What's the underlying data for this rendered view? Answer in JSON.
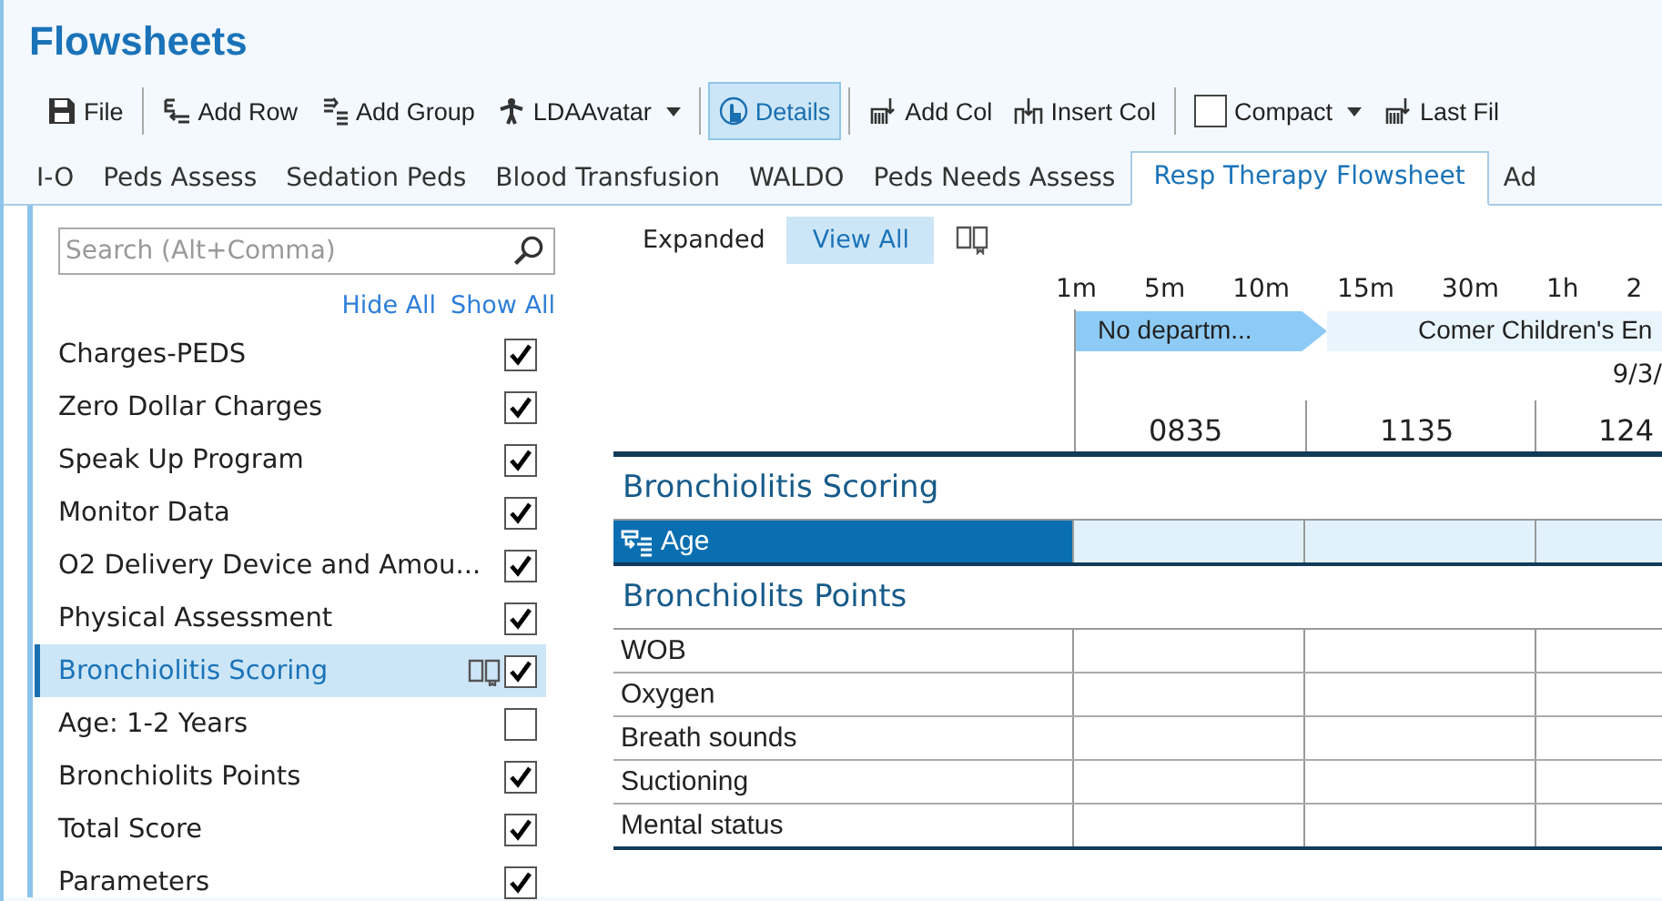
{
  "window": {
    "title": "Flowsheets"
  },
  "toolbar_groups": [
    [
      {
        "label": "File",
        "kind": "save",
        "selected": false,
        "dropdown": false
      }
    ],
    [
      {
        "label": "Add Row",
        "kind": "addrow",
        "selected": false,
        "dropdown": false
      },
      {
        "label": "Add Group",
        "kind": "addgroup",
        "selected": false,
        "dropdown": false
      },
      {
        "label": "LDAAvatar",
        "kind": "figure",
        "selected": false,
        "dropdown": true
      }
    ],
    [
      {
        "label": "Details",
        "kind": "hand",
        "selected": true,
        "dropdown": false
      }
    ],
    [
      {
        "label": "Add Col",
        "kind": "addcol",
        "selected": false,
        "dropdown": false
      },
      {
        "label": "Insert Col",
        "kind": "insertcol",
        "selected": false,
        "dropdown": false
      }
    ],
    [
      {
        "label": "Compact",
        "kind": "checkbox",
        "selected": false,
        "dropdown": true
      },
      {
        "label": "Last Fil",
        "kind": "addcol",
        "selected": false,
        "dropdown": false
      }
    ]
  ],
  "tabs": [
    {
      "label": "I-O",
      "selected": false
    },
    {
      "label": "Peds Assess",
      "selected": false
    },
    {
      "label": "Sedation Peds",
      "selected": false
    },
    {
      "label": "Blood Transfusion",
      "selected": false
    },
    {
      "label": "WALDO",
      "selected": false
    },
    {
      "label": "Peds Needs Assess",
      "selected": false
    },
    {
      "label": "Resp Therapy Flowsheet",
      "selected": true
    },
    {
      "label": "Ad",
      "selected": false
    }
  ],
  "sidebar": {
    "search": {
      "placeholder": "Search (Alt+Comma)"
    },
    "links": [
      "Hide All",
      "Show All"
    ],
    "items": [
      {
        "label": "Charges-PEDS",
        "checked": true,
        "selected": false
      },
      {
        "label": "Zero Dollar Charges",
        "checked": true,
        "selected": false
      },
      {
        "label": "Speak Up Program",
        "checked": true,
        "selected": false
      },
      {
        "label": "Monitor Data",
        "checked": true,
        "selected": false
      },
      {
        "label": "O2 Delivery Device and Amou...",
        "checked": true,
        "selected": false
      },
      {
        "label": "Physical Assessment",
        "checked": true,
        "selected": false
      },
      {
        "label": "Bronchiolitis Scoring",
        "checked": true,
        "selected": true
      },
      {
        "label": "Age:  1-2 Years",
        "checked": false,
        "selected": false
      },
      {
        "label": "Bronchiolits Points",
        "checked": true,
        "selected": false
      },
      {
        "label": "Total Score",
        "checked": true,
        "selected": false
      },
      {
        "label": "Parameters",
        "checked": true,
        "selected": false
      }
    ]
  },
  "view_buttons": [
    {
      "label": "Expanded",
      "selected": false
    },
    {
      "label": "View All",
      "selected": true
    }
  ],
  "time_scale": [
    "1m",
    "5m",
    "10m",
    "15m",
    "30m",
    "1h",
    "2"
  ],
  "departments": [
    {
      "label": "No departm...",
      "current": true
    },
    {
      "label": "Comer Children's En",
      "current": false
    }
  ],
  "date": "9/3/",
  "columns": [
    "0835",
    "1135",
    "124"
  ],
  "groups": [
    {
      "title": "Bronchiolitis Scoring",
      "rows": [
        {
          "label": "Age",
          "selected": true
        }
      ]
    },
    {
      "title": "Bronchiolits Points",
      "rows": [
        {
          "label": "WOB",
          "selected": false
        },
        {
          "label": "Oxygen",
          "selected": false
        },
        {
          "label": "Breath sounds",
          "selected": false
        },
        {
          "label": "Suctioning",
          "selected": false
        },
        {
          "label": "Mental status",
          "selected": false
        }
      ]
    }
  ]
}
